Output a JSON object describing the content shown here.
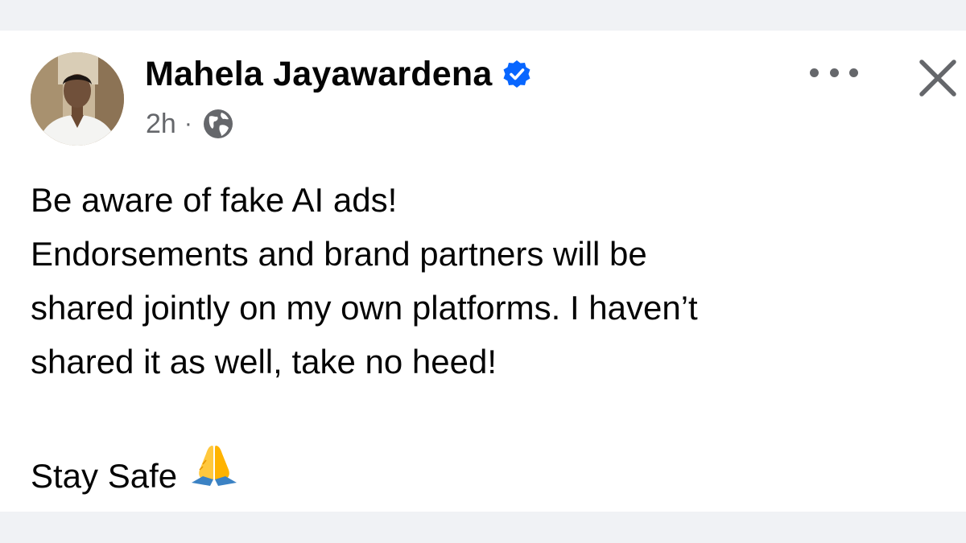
{
  "post": {
    "author_name": "Mahela Jayawardena",
    "timestamp": "2h",
    "separator": "·",
    "audience_icon": "globe-icon",
    "verified_icon": "verified-badge-icon",
    "lines": [
      "Be aware of fake AI ads!",
      "Endorsements and brand partners will be",
      "shared jointly on my own platforms. I haven’t",
      "shared it as well, take no heed!"
    ],
    "sign_off": "Stay Safe",
    "sign_off_emoji": "folded-hands-icon"
  },
  "actions": {
    "more_icon": "more-options-icon",
    "close_icon": "close-icon"
  },
  "colors": {
    "page_background": "#f0f2f5",
    "card_background": "#ffffff",
    "text_primary": "#050505",
    "text_secondary": "#65676b",
    "verified_blue": "#0866ff"
  }
}
